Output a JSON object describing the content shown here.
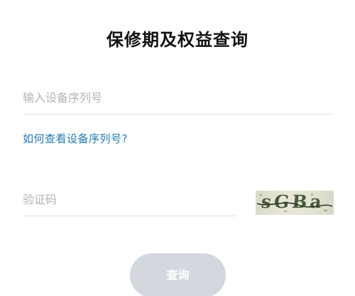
{
  "page": {
    "title": "保修期及权益查询"
  },
  "serial": {
    "placeholder": "输入设备序列号",
    "value": ""
  },
  "help": {
    "link_text": "如何查看设备序列号?"
  },
  "captcha": {
    "placeholder": "验证码",
    "value": "",
    "image_text": "sGBa"
  },
  "submit": {
    "label": "查询"
  },
  "colors": {
    "link": "#1f7ab3",
    "button_bg": "#d3d8df",
    "placeholder": "#b3b3b3"
  }
}
